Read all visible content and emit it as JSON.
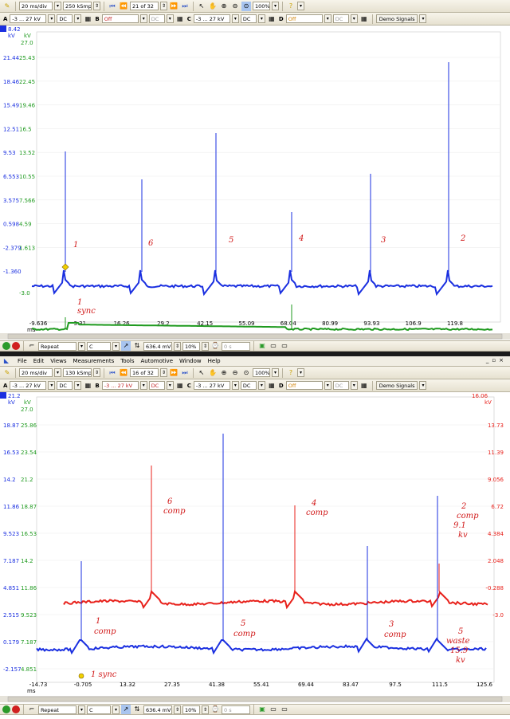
{
  "window1": {
    "toolbar": {
      "timebase": "20 ms/div",
      "samples": "250 kSmpl",
      "capture": "21 of 32",
      "zoom": "100%"
    },
    "channels": [
      {
        "label": "A",
        "range": "-3 ... 27 kV",
        "coupling": "DC"
      },
      {
        "label": "B",
        "range": "Off",
        "coupling": "DC"
      },
      {
        "label": "C",
        "range": "-3 ... 27 kV",
        "coupling": "DC"
      },
      {
        "label": "D",
        "range": "Off",
        "coupling": "DC"
      }
    ],
    "demo_label": "Demo Signals",
    "header_value": "8.42",
    "unit_blue": "kV",
    "unit_green": "kV",
    "green_top": "27.0",
    "y_blue": [
      "21.44",
      "18.46",
      "15.49",
      "12.51",
      "9.53",
      "6.553",
      "3.575",
      "0.598",
      "-2.379",
      "-1.360"
    ],
    "y_green": [
      "25.43",
      "22.45",
      "19.46",
      "16.5",
      "13.52",
      "10.55",
      "7.566",
      "4.59",
      "1.613",
      "-3.0"
    ],
    "x_ticks": [
      "-9.636",
      "3.31",
      "16.26",
      "29.2",
      "42.15",
      "55.09",
      "68.04",
      "80.99",
      "93.93",
      "106.9",
      "119.8"
    ],
    "x_unit": "ms",
    "annotations": [
      "1",
      "6",
      "5",
      "4",
      "3",
      "2",
      "1",
      "sync"
    ],
    "bottom": {
      "trigger_mode": "Repeat",
      "channel": "C",
      "level": "636.4 mV",
      "pretrigger": "10%",
      "delay": "0 s"
    }
  },
  "window2": {
    "menu": [
      "File",
      "Edit",
      "Views",
      "Measurements",
      "Tools",
      "Automotive",
      "Window",
      "Help"
    ],
    "toolbar": {
      "timebase": "20 ms/div",
      "samples": "130 kSmpl",
      "capture": "16 of 32",
      "zoom": "100%"
    },
    "channels": [
      {
        "label": "A",
        "range": "-3 ... 27 kV",
        "coupling": "DC"
      },
      {
        "label": "B",
        "range": "-3 ... 27 kV",
        "coupling": "DC"
      },
      {
        "label": "C",
        "range": "-3 ... 27 kV",
        "coupling": "DC"
      },
      {
        "label": "D",
        "range": "Off",
        "coupling": "DC"
      }
    ],
    "demo_label": "Demo Signals",
    "header_value": "21.2",
    "header_right": "16.06",
    "unit_blue": "kV",
    "unit_green": "kV",
    "unit_red": "kV",
    "green_top": "27.0",
    "y_blue": [
      "18.87",
      "16.53",
      "14.2",
      "11.86",
      "9.523",
      "7.187",
      "4.851",
      "2.515",
      "0.179",
      "-2.157"
    ],
    "y_green": [
      "25.86",
      "23.54",
      "21.2",
      "18.87",
      "16.53",
      "14.2",
      "11.86",
      "9.523",
      "7.187",
      "4.851"
    ],
    "y_red": [
      "13.73",
      "11.39",
      "9.056",
      "6.72",
      "4.384",
      "2.048",
      "-0.288",
      "-3.0"
    ],
    "x_ticks": [
      "-14.73",
      "-0.705",
      "13.32",
      "27.35",
      "41.38",
      "55.41",
      "69.44",
      "83.47",
      "97.5",
      "111.5",
      "125.6"
    ],
    "x_unit": "ms",
    "annotations": [
      "6",
      "comp",
      "4",
      "comp",
      "2",
      "comp",
      "9.1",
      "kv",
      "1",
      "comp",
      "5",
      "comp",
      "3",
      "comp",
      "5",
      "waste",
      "15.9",
      "kv",
      "1 sync"
    ],
    "bottom": {
      "trigger_mode": "Repeat",
      "channel": "C",
      "level": "636.4 mV",
      "pretrigger": "10%",
      "delay": "0 s"
    }
  },
  "colors": {
    "blue": "#1a2fe0",
    "green": "#1f9a1f",
    "red": "#e8211b",
    "annotation": "#d11a1a",
    "toolbar": "#ece8da"
  }
}
